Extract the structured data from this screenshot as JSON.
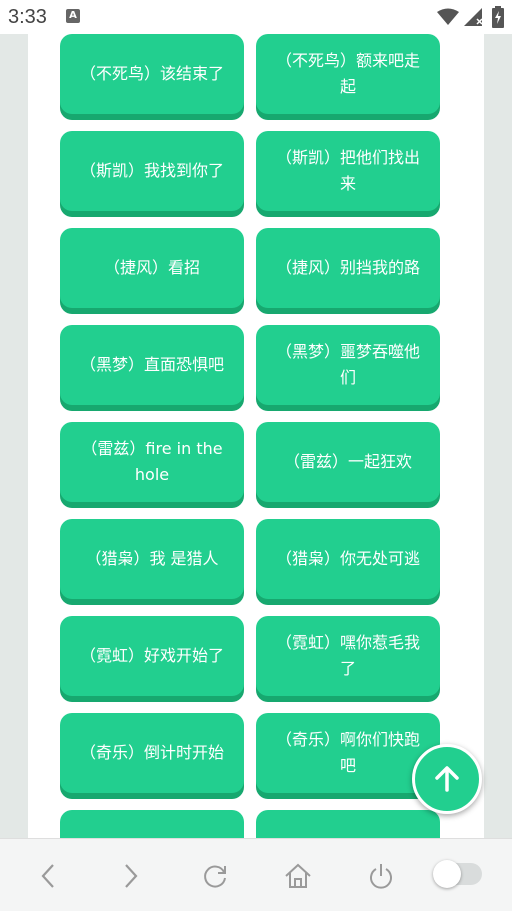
{
  "status_bar": {
    "time": "3:33",
    "notification_letter": "A"
  },
  "buttons": [
    [
      "（不死鸟）该结束了",
      "（不死鸟）额来吧走起"
    ],
    [
      "（斯凯）我找到你了",
      "（斯凯）把他们找出来"
    ],
    [
      "（捷风）看招",
      "（捷风）别挡我的路"
    ],
    [
      "（黑梦）直面恐惧吧",
      "（黑梦）噩梦吞噬他们"
    ],
    [
      "（雷兹）fire in the hole",
      "（雷兹）一起狂欢"
    ],
    [
      "（猎枭）我 是猎人",
      "（猎枭）你无处可逃"
    ],
    [
      "（霓虹）好戏开始了",
      "（霓虹）嘿你惹毛我了"
    ],
    [
      "（奇乐）倒计时开始",
      "（奇乐）啊你们快跑吧"
    ],
    [
      "",
      ""
    ]
  ],
  "colors": {
    "accent": "#22cf8f",
    "accent_shadow": "#17a86f"
  },
  "icons": {
    "fab": "arrow-up-icon",
    "nav": [
      "back-icon",
      "forward-icon",
      "refresh-icon",
      "home-icon",
      "power-icon",
      "toggle-switch"
    ]
  }
}
